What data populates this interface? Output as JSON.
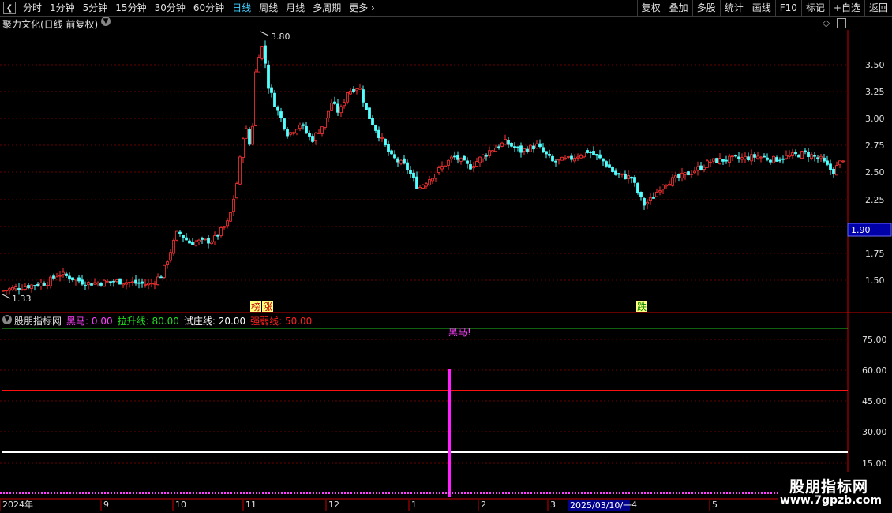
{
  "toolbar": {
    "periods": [
      "分时",
      "1分钟",
      "5分钟",
      "15分钟",
      "30分钟",
      "60分钟",
      "日线",
      "周线",
      "月线",
      "多周期"
    ],
    "active_period": "日线",
    "more": "更多",
    "right_buttons": [
      "复权",
      "叠加",
      "多股",
      "统计",
      "画线",
      "F10",
      "标记",
      "+自选",
      "返回"
    ]
  },
  "main_chart": {
    "title": "聚力文化(日线 前复权)",
    "y_ticks": [
      "3.50",
      "3.25",
      "3.00",
      "2.75",
      "2.50",
      "2.25",
      "1.75",
      "1.50"
    ],
    "high_label": "3.80",
    "low_label": "1.33",
    "current_price_label": "1.90",
    "annotations": {
      "bang": "榜",
      "zhang": "涨",
      "die": "跌"
    }
  },
  "indicator": {
    "name": "股朋指标网",
    "items": [
      {
        "label": "黑马:",
        "value": "0.00",
        "color": "#ff40ff"
      },
      {
        "label": "拉升线:",
        "value": "80.00",
        "color": "#20e020"
      },
      {
        "label": "试庄线:",
        "value": "20.00",
        "color": "#ffffff"
      },
      {
        "label": "强弱线:",
        "value": "50.00",
        "color": "#ff2020"
      }
    ],
    "signal_text": "黑马!",
    "y_ticks": [
      "75.00",
      "60.00",
      "45.00",
      "30.00",
      "15.00"
    ]
  },
  "time_axis": {
    "labels": [
      "2024年",
      "9",
      "10",
      "11",
      "12",
      "1",
      "2",
      "3",
      "4",
      "5"
    ],
    "cursor_date": "2025/03/10/一"
  },
  "watermark": {
    "line1": "股朋指标网",
    "line2": "www.7gpzb.com"
  },
  "colors": {
    "up": "#ff3232",
    "down": "#54ffff",
    "grid": "#6a0000",
    "axis": "#c80000"
  }
}
